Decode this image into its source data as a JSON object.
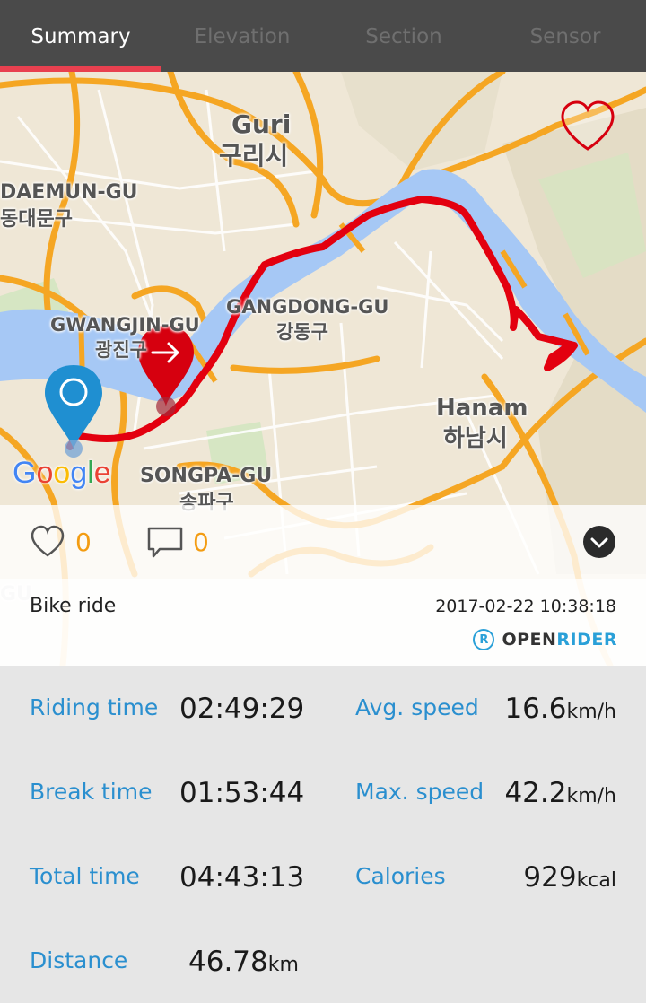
{
  "tabs": [
    {
      "label": "Summary",
      "active": true
    },
    {
      "label": "Elevation",
      "active": false
    },
    {
      "label": "Section",
      "active": false
    },
    {
      "label": "Sensor",
      "active": false
    }
  ],
  "map": {
    "labels": {
      "guri_en": "Guri",
      "guri_ko": "구리시",
      "dongdaemun": "DAEMUN-GU",
      "dongdaemun_ko": "동대문구",
      "gwangjin": "GWANGJIN-GU",
      "gwangjin_ko": "광진구",
      "gangdong": "GANGDONG-GU",
      "gangdong_ko": "강동구",
      "hanam_en": "Hanam",
      "hanam_ko": "하남시",
      "songpa": "SONGPA-GU",
      "songpa_ko": "송파구",
      "gu": "GU"
    },
    "google_letters": [
      "G",
      "o",
      "o",
      "g",
      "l",
      "e"
    ],
    "google_colors": [
      "#4285F4",
      "#EA4335",
      "#FBBC05",
      "#4285F4",
      "#34A853",
      "#EA4335"
    ],
    "route_color": "#e3000f",
    "river_color": "#a6c8f5"
  },
  "social": {
    "likes": "0",
    "comments": "0"
  },
  "activity": {
    "type": "Bike ride",
    "datetime": "2017-02-22 10:38:18",
    "brand_logo": "R",
    "brand_open": "OPEN",
    "brand_rider": "RIDER"
  },
  "stats": {
    "riding_time": {
      "label": "Riding time",
      "value": "02:49:29"
    },
    "break_time": {
      "label": "Break time",
      "value": "01:53:44"
    },
    "total_time": {
      "label": "Total time",
      "value": "04:43:13"
    },
    "distance": {
      "label": "Distance",
      "value": "46.78",
      "unit": "km"
    },
    "avg_speed": {
      "label": "Avg. speed",
      "value": "16.6",
      "unit": "km/h"
    },
    "max_speed": {
      "label": "Max. speed",
      "value": "42.2",
      "unit": "km/h"
    },
    "calories": {
      "label": "Calories",
      "value": "929",
      "unit": "kcal"
    }
  },
  "colors": {
    "accent": "#e8404f",
    "label_blue": "#2a8fcf",
    "count_orange": "#f39c12"
  }
}
